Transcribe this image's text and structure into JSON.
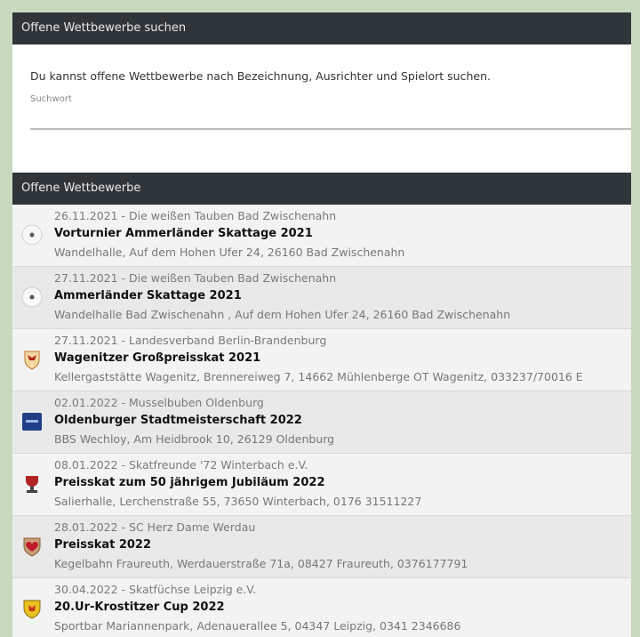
{
  "search_panel": {
    "header": "Offene Wettbewerbe suchen",
    "description": "Du kannst offene Wettbewerbe nach Bezeichnung, Ausrichter und Spielort suchen.",
    "field_label": "Suchwort",
    "value": ""
  },
  "list_panel": {
    "header": "Offene Wettbewerbe"
  },
  "competitions": [
    {
      "meta": "26.11.2021 - Die weißen Tauben Bad Zwischenahn",
      "title": "Vorturnier Ammerländer Skattage 2021",
      "location": "Wandelhalle, Auf dem Hohen Ufer 24, 26160 Bad Zwischenahn",
      "logo": "white-dove-club-logo-icon"
    },
    {
      "meta": "27.11.2021 - Die weißen Tauben Bad Zwischenahn",
      "title": "Ammerländer Skattage 2021",
      "location": "Wandelhalle Bad Zwischenahn , Auf dem Hohen Ufer 24, 26160 Bad Zwischenahn",
      "logo": "white-dove-club-logo-icon"
    },
    {
      "meta": "27.11.2021 - Landesverband Berlin-Brandenburg",
      "title": "Wagenitzer Großpreisskat 2021",
      "location": "Kellergaststätte Wagenitz, Brennereiweg 7, 14662 Mühlenberge OT Wagenitz, 033237/70016 E",
      "logo": "brandenburg-eagle-crest-icon"
    },
    {
      "meta": "02.01.2022 - Musselbuben Oldenburg",
      "title": "Oldenburger Stadtmeisterschaft 2022",
      "location": "BBS Wechloy, Am Heidbrook 10, 26129 Oldenburg",
      "logo": "blue-square-club-logo-icon"
    },
    {
      "meta": "08.01.2022 - Skatfreunde '72 Winterbach e.V.",
      "title": "Preisskat zum 50 jährigem Jubiläum 2022",
      "location": "Salierhalle, Lerchenstraße 55, 73650 Winterbach, 0176 31511227",
      "logo": "red-cup-club-logo-icon"
    },
    {
      "meta": "28.01.2022 - SC Herz Dame Werdau",
      "title": "Preisskat 2022",
      "location": "Kegelbahn Fraureuth, Werdauerstraße 71a, 08427 Fraureuth, 0376177791",
      "logo": "red-heart-shield-icon"
    },
    {
      "meta": "30.04.2022 - Skatfüchse Leipzig e.V.",
      "title": "20.Ur-Krostitzer Cup 2022",
      "location": "Sportbar Mariannenpark, Adenauerallee 5, 04347 Leipzig, 0341 2346686",
      "logo": "yellow-fox-shield-icon"
    }
  ]
}
